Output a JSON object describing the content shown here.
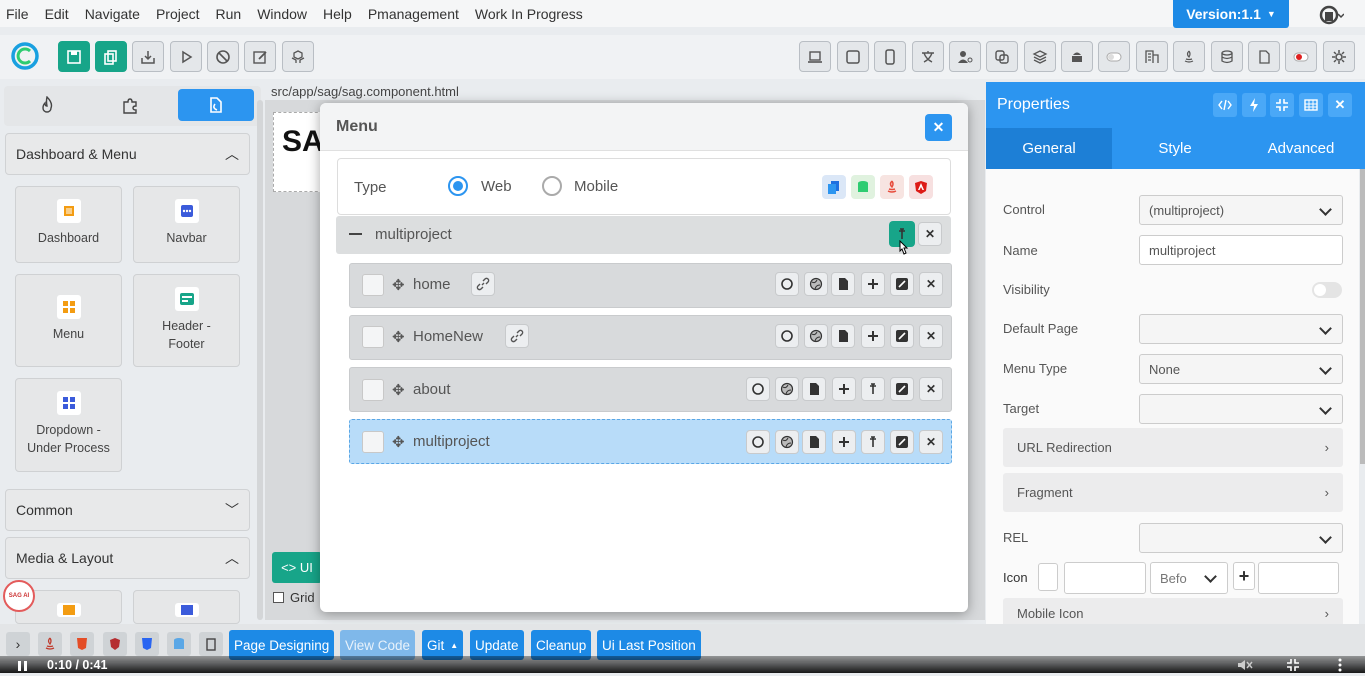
{
  "menubar": {
    "items": [
      "File",
      "Edit",
      "Navigate",
      "Project",
      "Run",
      "Window",
      "Help",
      "Pmanagement",
      "Work In Progress"
    ],
    "version": "Version:1.1"
  },
  "left_panel": {
    "sections": {
      "dashboard_menu": "Dashboard & Menu",
      "common": "Common",
      "media_layout": "Media & Layout"
    },
    "components": [
      "Dashboard",
      "Navbar",
      "Menu",
      "Header -\nFooter",
      "Dropdown -\nUnder Process"
    ]
  },
  "canvas": {
    "file_path": "src/app/sag/sag.component.html",
    "ui_tag": "UI",
    "grid_label": "Grid",
    "logo_text": "SA"
  },
  "modal": {
    "title": "Menu",
    "type_label": "Type",
    "type_options": [
      "Web",
      "Mobile"
    ],
    "selected_type": "Web",
    "root_item": "multiproject",
    "items": [
      {
        "label": "home"
      },
      {
        "label": "HomeNew"
      },
      {
        "label": "about"
      },
      {
        "label": "multiproject"
      }
    ]
  },
  "properties": {
    "title": "Properties",
    "tabs": [
      "General",
      "Style",
      "Advanced"
    ],
    "active_tab": "General",
    "fields": {
      "control_label": "Control",
      "control_value": "(multiproject)",
      "name_label": "Name",
      "name_value": "multiproject",
      "visibility_label": "Visibility",
      "default_page_label": "Default Page",
      "menu_type_label": "Menu Type",
      "menu_type_value": "None",
      "target_label": "Target",
      "url_redirection": "URL Redirection",
      "fragment": "Fragment",
      "rel_label": "REL",
      "icon_label": "Icon",
      "icon_position": "Befo",
      "mobile_icon": "Mobile Icon"
    }
  },
  "bottombar": {
    "buttons": [
      "Page Designing",
      "View Code",
      "Git",
      "Update",
      "Cleanup",
      "Ui Last Position"
    ]
  },
  "video": {
    "time": "0:10 / 0:41"
  },
  "badge": {
    "sagai": "SAG AI"
  },
  "colors": {
    "accent": "#2c95f0",
    "green": "#17a589",
    "selected_row": "#b8dcf9"
  }
}
